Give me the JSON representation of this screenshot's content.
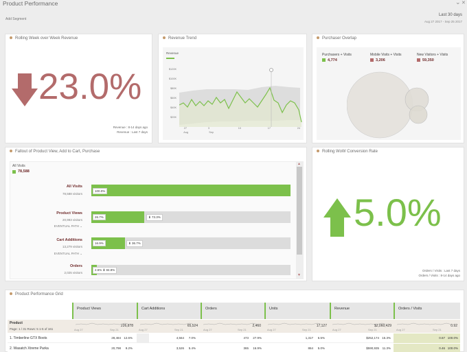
{
  "app": {
    "title": "Product Performance",
    "add_segment": "Add Segment",
    "date_range": "Last 30 days",
    "date_sub": "Aug 27 2017 - Sep 25 2017"
  },
  "p1": {
    "title": "Rolling Week over Week Revenue",
    "value": "23.0%",
    "note1": "Revenue : 8-14 days ago",
    "note2": "Revenue : Last 7 days"
  },
  "p2": {
    "title": "Revenue Trend",
    "legend": "Revenue",
    "yticks": [
      "$120K",
      "$100K",
      "$80K",
      "$60K",
      "$40K",
      "$20K"
    ],
    "xticks": [
      "27",
      "3",
      "10",
      "17",
      "24"
    ],
    "xsub": [
      "Aug",
      "Sep"
    ]
  },
  "p3": {
    "title": "Purchaser Overlap",
    "s1": {
      "label": "Purchasers + Visits",
      "value": "4,774",
      "color": "#7cc04b"
    },
    "s2": {
      "label": "Mobile Visits + Visits",
      "value": "3,206",
      "color": "#b36b6b"
    },
    "s3": {
      "label": "New Visitors + Visits",
      "value": "59,350",
      "color": "#b36b6b"
    }
  },
  "p4": {
    "title": "Fallout of Product View, Add to Cart, Purchase",
    "all_label": "All Visits",
    "all_value": "78,588",
    "steps": [
      {
        "name": "All Visits",
        "visitors": "78,588 visitors",
        "pct": "100.0%"
      },
      {
        "name": "Product Views",
        "visitors": "20,993 visitors",
        "pct": "26.7%",
        "next": "73.3%",
        "path": "EVENTUAL PATH"
      },
      {
        "name": "Cart Additions",
        "visitors": "13,279 visitors",
        "pct": "16.9%",
        "next": "36.7%",
        "path": "EVENTUAL PATH"
      },
      {
        "name": "Orders",
        "visitors": "2,025 visitors",
        "pct": "2.6%",
        "next": "84.8%"
      }
    ]
  },
  "p5": {
    "title": "Rolling WoW Conversion Rate",
    "value": "5.0%",
    "note1": "Orders / Visits : Last 7 days",
    "note2": "Orders / Visits : 8-14 days ago"
  },
  "grid": {
    "title": "Product Performance Grid",
    "dim": "Product",
    "page": "Page: 1 / 31   Rows: 5   1-5 of 161",
    "cols": [
      "Product Views",
      "Cart Additions",
      "Orders",
      "Units",
      "Revenue",
      "Orders / Visits"
    ],
    "totals": [
      "226,878",
      "65,524",
      "2,460",
      "17,127",
      "$2,060,429",
      "0.92"
    ],
    "spark_start": "Aug 27",
    "spark_end": "Sep 21",
    "rows": [
      {
        "name": "1.  Timberline GTX Boots",
        "vals": [
          "28,484",
          "12.6%",
          "4,564",
          "7.0%",
          "473",
          "27.9%",
          "1,317",
          "6.5%",
          "$252,174",
          "15.3%",
          "0.67",
          "100.0%"
        ]
      },
      {
        "name": "2.  Wasatch Xtreme Parka",
        "vals": [
          "20,798",
          "9.2%",
          "3,526",
          "5.4%",
          "365",
          "16.9%",
          "864",
          "5.0%",
          "$590,935",
          "11.3%",
          "0.46",
          "100.0%"
        ]
      }
    ]
  }
}
